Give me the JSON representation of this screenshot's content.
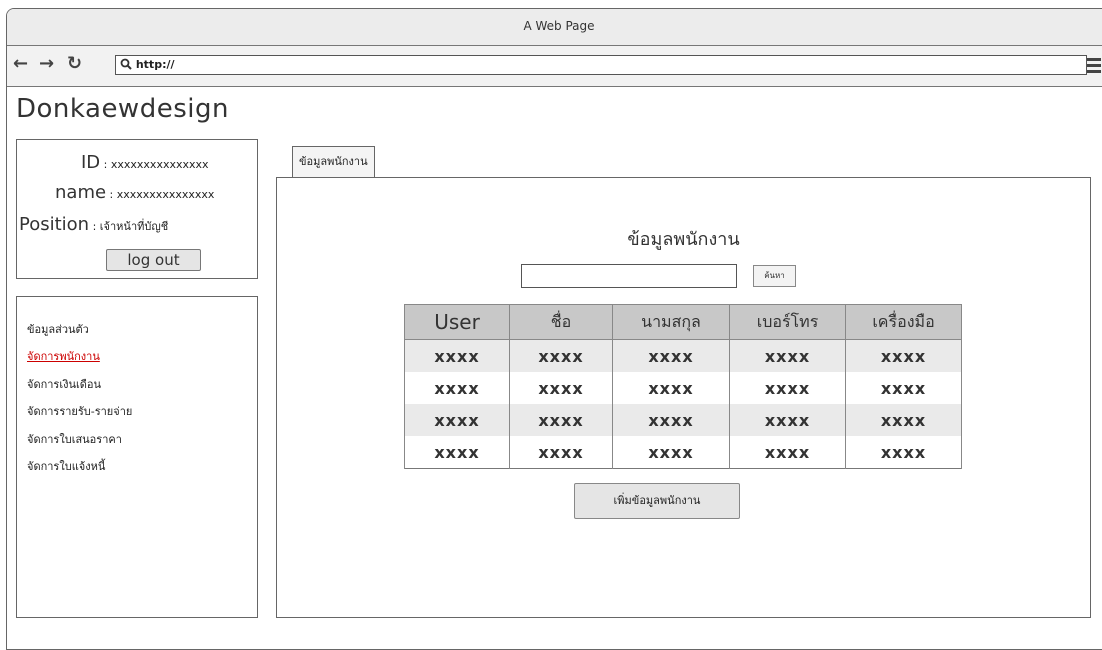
{
  "browser": {
    "title": "A Web Page",
    "url": "http://"
  },
  "brand": "Donkaewdesign",
  "profile": {
    "id_label": "ID",
    "id_value": "xxxxxxxxxxxxxxx",
    "name_label": "name",
    "name_value": "xxxxxxxxxxxxxxx",
    "position_label": "Position",
    "position_value": "เจ้าหน้าที่บัญชี",
    "separator": " : ",
    "logout_label": "log out"
  },
  "sidebar": {
    "items": [
      {
        "label": "ข้อมูลส่วนตัว",
        "active": false
      },
      {
        "label": "จัดการพนักงาน",
        "active": true
      },
      {
        "label": "จัดการเงินเดือน",
        "active": false
      },
      {
        "label": "จัดการรายรับ-รายจ่าย",
        "active": false
      },
      {
        "label": "จัดการใบเสนอราคา",
        "active": false
      },
      {
        "label": "จัดการใบแจ้งหนี้",
        "active": false
      }
    ]
  },
  "main": {
    "tab_label": "ข้อมูลพนักงาน",
    "title": "ข้อมูลพนักงาน",
    "search": {
      "value": "",
      "button_label": "ค้นหา"
    },
    "table": {
      "columns": [
        "User",
        "ชื่อ",
        "นามสกุล",
        "เบอร์โทร",
        "เครื่องมือ"
      ],
      "rows": [
        [
          "xxxx",
          "xxxx",
          "xxxx",
          "xxxx",
          "xxxx"
        ],
        [
          "xxxx",
          "xxxx",
          "xxxx",
          "xxxx",
          "xxxx"
        ],
        [
          "xxxx",
          "xxxx",
          "xxxx",
          "xxxx",
          "xxxx"
        ],
        [
          "xxxx",
          "xxxx",
          "xxxx",
          "xxxx",
          "xxxx"
        ]
      ]
    },
    "add_button_label": "เพิ่มข้อมูลพนักงาน"
  },
  "colors": {
    "active_link": "#cc0000",
    "table_header": "#c8c8c8",
    "row_stripe": "#eaeaea"
  }
}
